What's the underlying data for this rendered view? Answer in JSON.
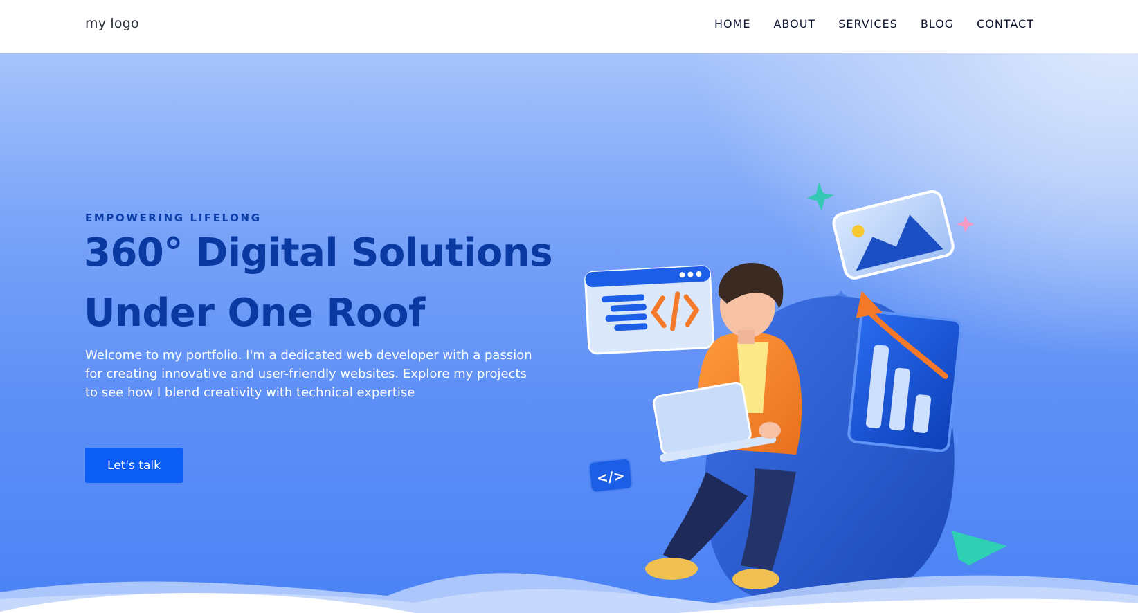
{
  "header": {
    "logo": "my logo",
    "nav": [
      {
        "label": "HOME"
      },
      {
        "label": "ABOUT"
      },
      {
        "label": "SERVICES"
      },
      {
        "label": "BLOG"
      },
      {
        "label": "CONTACT"
      }
    ]
  },
  "hero": {
    "eyebrow": "EMPOWERING LIFELONG",
    "headline_line1": "360° Digital Solutions",
    "headline_line2": "Under One Roof",
    "intro": "Welcome to my portfolio. I'm a dedicated web developer with a passion for creating innovative and user-friendly websites. Explore my projects to see how I blend creativity with technical expertise",
    "cta_label": "Let's talk",
    "illustration_code_badge": "</>"
  },
  "colors": {
    "accent": "#0b5df5",
    "headline": "#0a3aa1",
    "hero_top": "#a6c3fb",
    "hero_bottom": "#4a82f5"
  }
}
